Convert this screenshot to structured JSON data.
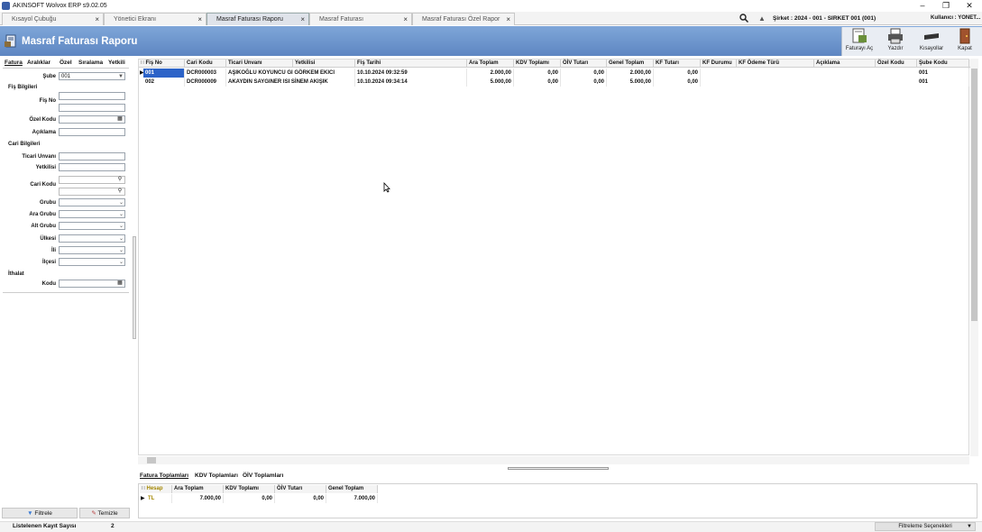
{
  "window": {
    "title": "AKINSOFT Wolvox ERP s9.02.05",
    "minimize": "–",
    "restore": "❐",
    "close": "✕"
  },
  "tabs": [
    {
      "label": "Kısayol Çubuğu"
    },
    {
      "label": "Yönetici Ekranı"
    },
    {
      "label": "Masraf Faturası Raporu"
    },
    {
      "label": "Masraf Faturası"
    },
    {
      "label": "Masraf Faturası Özel Rapor"
    }
  ],
  "tab_close": "×",
  "topbar": {
    "company": "Şirket : 2024 - 001 - SIRKET 001 (001)",
    "user": "Kullanıcı : YONET..."
  },
  "header": {
    "title": "Masraf Faturası Raporu",
    "buttons": [
      {
        "label": "Faturayı Aç",
        "icon": "invoice-open-icon"
      },
      {
        "label": "Yazdır",
        "icon": "printer-icon"
      },
      {
        "label": "Kısayollar",
        "icon": "shortcuts-icon"
      },
      {
        "label": "Kapat",
        "icon": "door-close-icon"
      }
    ]
  },
  "left_tabs": [
    "Fatura",
    "Aralıklar",
    "Özel",
    "Sıralama",
    "Yetkili"
  ],
  "left": {
    "sube_label": "Şube",
    "sube_value": "001",
    "fis_bilgileri": "Fiş Bilgileri",
    "fis_no": "Fiş No",
    "ozel_kodu": "Özel Kodu",
    "aciklama": "Açıklama",
    "cari_bilgileri": "Cari Bilgileri",
    "ticari_unvani": "Ticari Unvanı",
    "yetkilisi": "Yetkilisi",
    "cari_kodu": "Cari Kodu",
    "grubu": "Grubu",
    "ara_grubu": "Ara Grubu",
    "alt_grubu": "Alt Grubu",
    "ulkesi": "Ülkesi",
    "il": "İli",
    "ilcesi": "İlçesi",
    "ithalat": "İthalat",
    "kodu": "Kodu",
    "filter_button": "Filtrele",
    "clear_button": "Temizle"
  },
  "grid": {
    "columns": [
      "Fiş No",
      "Cari Kodu",
      "Ticari Unvanı",
      "Yetkilisi",
      "Fiş Tarihi",
      "Ara Toplam",
      "KDV Toplamı",
      "ÖİV Tutarı",
      "Genel Toplam",
      "KF Tutarı",
      "KF Durumu",
      "KF Ödeme Türü",
      "Açıklama",
      "Özel Kodu",
      "Şube Kodu"
    ],
    "rows": [
      [
        "001",
        "DCR000003",
        "AŞIKOĞLU KOYUNCU GI GÖRKEM EKICI",
        "",
        "10.10.2024 09:32:59",
        "2.000,00",
        "0,00",
        "0,00",
        "2.000,00",
        "0,00",
        "",
        "",
        "",
        "",
        "001"
      ],
      [
        "002",
        "DCR000009",
        "AKAYDIN SAYGINER ISI SİNEM AKIŞIK",
        "",
        "10.10.2024 09:34:14",
        "5.000,00",
        "0,00",
        "0,00",
        "5.000,00",
        "0,00",
        "",
        "",
        "",
        "",
        "001"
      ]
    ]
  },
  "bottom_tabs": [
    "Fatura Toplamları",
    "KDV Toplamları",
    "ÖİV Toplamları"
  ],
  "summary": {
    "columns": [
      "Hesap",
      "Ara Toplam",
      "KDV Toplamı",
      "ÖİV Tutarı",
      "Genel Toplam"
    ],
    "row": [
      "TL",
      "7.000,00",
      "0,00",
      "0,00",
      "7.000,00"
    ]
  },
  "status": {
    "label": "Listelenen Kayıt Sayısı",
    "count": "2",
    "filter_options": "Filtreleme Seçenekleri"
  }
}
